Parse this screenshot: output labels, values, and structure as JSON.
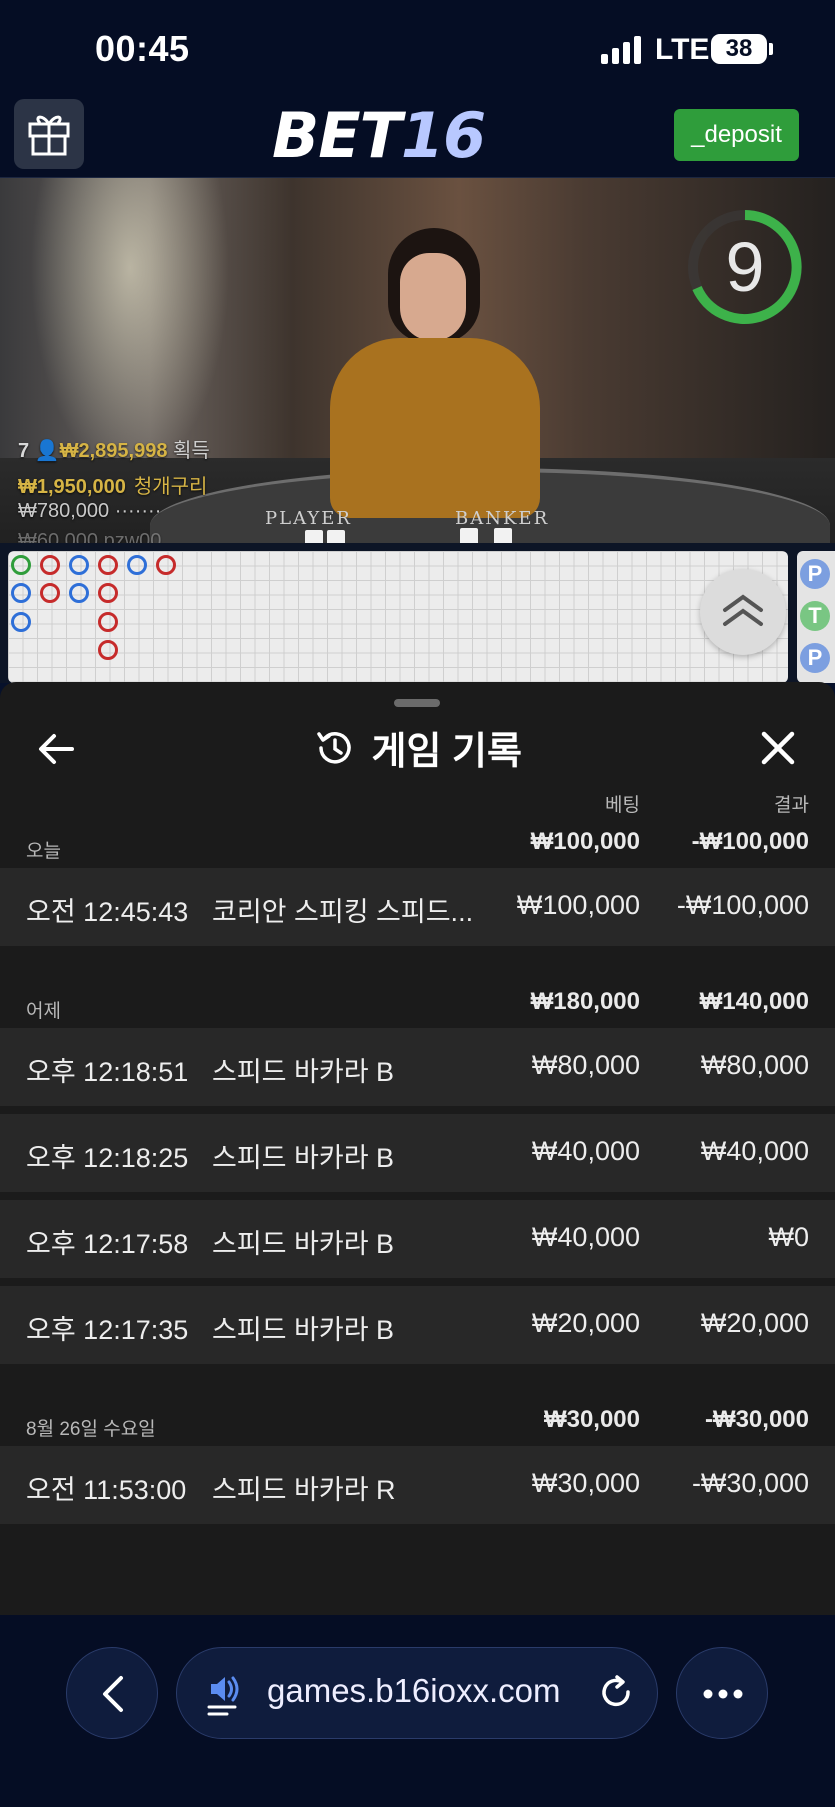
{
  "status_bar": {
    "time": "00:45",
    "network": "LTE",
    "battery": "38"
  },
  "header": {
    "logo_main": "BET",
    "logo_num": "16",
    "deposit_label": "_deposit"
  },
  "video": {
    "timer": "9",
    "players_count": "7",
    "players_amount": "₩2,895,998",
    "players_suffix": "획득",
    "top_win_amount": "₩1,950,000",
    "top_win_name": "청개구리",
    "second_amount": "₩780,000",
    "second_name": "·······",
    "third_partial": "₩60,000  pzw00",
    "player_label": "PLAYER",
    "banker_label": "BANKER"
  },
  "side_chips": [
    "P",
    "T",
    "P"
  ],
  "sheet": {
    "title": "게임 기록",
    "col_bet": "베팅",
    "col_result": "결과",
    "groups": [
      {
        "label": "오늘",
        "bet": "₩100,000",
        "result": "-₩100,000",
        "rows": [
          {
            "time": "오전 12:45:43",
            "game": "코리안 스피킹 스피드...",
            "bet": "₩100,000",
            "result": "-₩100,000"
          }
        ]
      },
      {
        "label": "어제",
        "bet": "₩180,000",
        "result": "₩140,000",
        "rows": [
          {
            "time": "오후 12:18:51",
            "game": "스피드 바카라 B",
            "bet": "₩80,000",
            "result": "₩80,000"
          },
          {
            "time": "오후 12:18:25",
            "game": "스피드 바카라 B",
            "bet": "₩40,000",
            "result": "₩40,000"
          },
          {
            "time": "오후 12:17:58",
            "game": "스피드 바카라 B",
            "bet": "₩40,000",
            "result": "₩0"
          },
          {
            "time": "오후 12:17:35",
            "game": "스피드 바카라 B",
            "bet": "₩20,000",
            "result": "₩20,000"
          }
        ]
      },
      {
        "label": "8월 26일 수요일",
        "bet": "₩30,000",
        "result": "-₩30,000",
        "rows": [
          {
            "time": "오전 11:53:00",
            "game": "스피드 바카라 R",
            "bet": "₩30,000",
            "result": "-₩30,000"
          }
        ]
      }
    ]
  },
  "browser": {
    "url": "games.b16ioxx.com"
  },
  "colors": {
    "deposit": "#2f9d3b",
    "banker_red": "#c62b2b",
    "player_blue": "#2e6fd8",
    "tie_green": "#2f9d3b",
    "timer_ring": "#3db24a"
  },
  "icons": {
    "gift": "gift-icon",
    "history": "history-icon",
    "back": "arrow-left-icon",
    "close": "close-icon",
    "chevron": "chevron-up-double-icon",
    "speaker": "speaker-icon",
    "reload": "reload-icon",
    "more": "more-icon"
  }
}
